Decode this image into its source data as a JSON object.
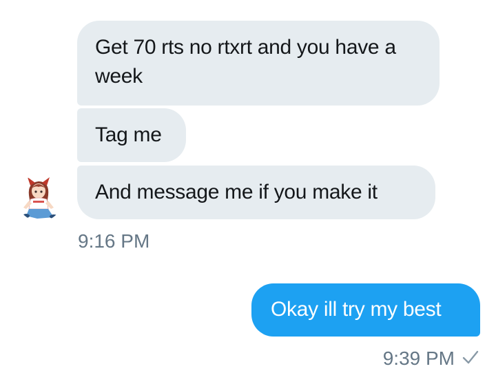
{
  "messages": [
    {
      "text": "Get 70 rts no rtxrt and you have a week"
    },
    {
      "text": "Tag me"
    },
    {
      "text": "And message me if you make it"
    },
    {
      "text": "Okay ill try my best"
    }
  ],
  "received_time": "9:16 PM",
  "sent_time": "9:39 PM",
  "avatar_icon": "anime-girl-avatar",
  "status_icon": "checkmark-icon",
  "colors": {
    "incoming_bubble": "#e6ecf0",
    "outgoing_bubble": "#1da1f2",
    "timestamp": "#657786"
  }
}
